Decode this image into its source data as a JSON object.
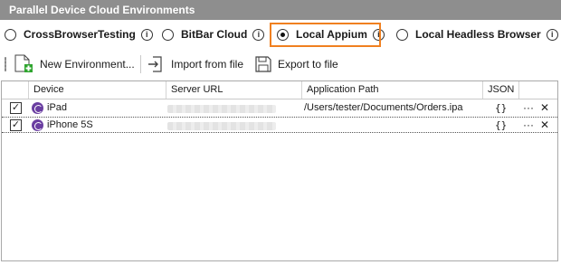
{
  "title": "Parallel Device Cloud Environments",
  "radio_options": [
    {
      "label": "CrossBrowserTesting",
      "checked": false
    },
    {
      "label": "BitBar Cloud",
      "checked": false
    },
    {
      "label": "Local Appium",
      "checked": true
    },
    {
      "label": "Local Headless Browser",
      "checked": false
    }
  ],
  "info_glyph": "i",
  "toolbar": {
    "new_environment": "New Environment...",
    "import": "Import from file",
    "export": "Export to file"
  },
  "columns": [
    "Device",
    "Server URL",
    "Application Path",
    "JSON"
  ],
  "rows": [
    {
      "checked": true,
      "device": "iPad",
      "server_url": "",
      "app_path": "/Users/tester/Documents/Orders.ipa",
      "json": "{}",
      "more": "···",
      "remove": "✕"
    },
    {
      "checked": true,
      "device": "iPhone 5S",
      "server_url": "",
      "app_path": "",
      "json": "{}",
      "more": "···",
      "remove": "✕"
    }
  ],
  "colors": {
    "highlight": "#f08020",
    "device_icon": "#6a3ea1",
    "titlebar": "#8e8e8e"
  }
}
